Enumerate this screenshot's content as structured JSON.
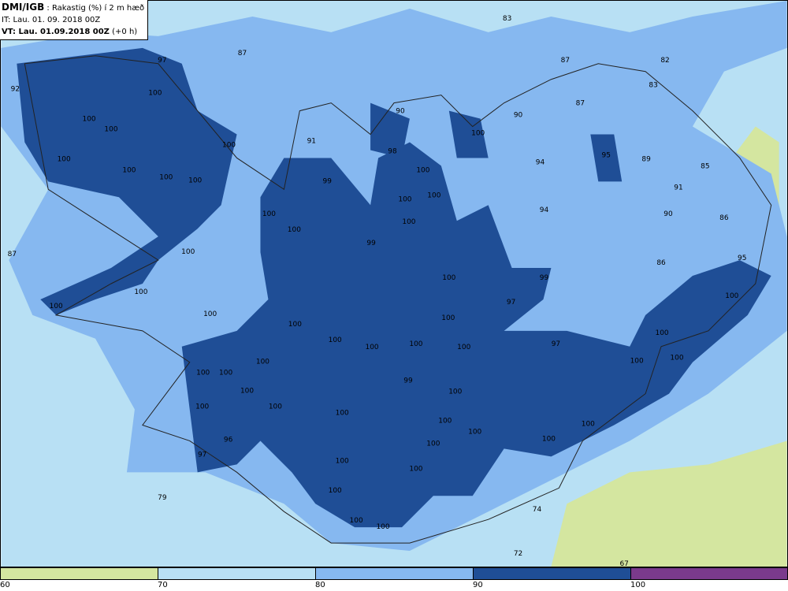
{
  "header": {
    "source": "DMI/IGB",
    "title": ": Rakastig (%) í 2 m hæð",
    "it": "IT: Lau. 01. 09. 2018 00Z",
    "vt_label": "VT: Lau. 01.09.2018 00Z",
    "vt_offset": "(+0 h)"
  },
  "legend": {
    "bins": [
      {
        "from": "60",
        "color": "#d4e6a0"
      },
      {
        "from": "70",
        "color": "#b8e0f4"
      },
      {
        "from": "80",
        "color": "#86b8f0"
      },
      {
        "from": "90",
        "color": "#1f4e96"
      },
      {
        "from": "100",
        "color": "#7a3a8c"
      }
    ]
  },
  "contour_labels": [
    "83",
    "87",
    "97",
    "87",
    "82",
    "92",
    "100",
    "83",
    "87",
    "90",
    "90",
    "100",
    "100",
    "100",
    "91",
    "100",
    "98",
    "95",
    "89",
    "100",
    "94",
    "85",
    "100",
    "100",
    "100",
    "100",
    "99",
    "91",
    "100",
    "100",
    "94",
    "90",
    "100",
    "100",
    "86",
    "100",
    "99",
    "100",
    "87",
    "86",
    "95",
    "100",
    "99",
    "100",
    "100",
    "97",
    "100",
    "100",
    "100",
    "100",
    "100",
    "100",
    "100",
    "100",
    "100",
    "97",
    "100",
    "100",
    "100",
    "100",
    "100",
    "99",
    "100",
    "100",
    "100",
    "100",
    "100",
    "100",
    "100",
    "100",
    "100",
    "96",
    "100",
    "97",
    "100",
    "100",
    "79",
    "100",
    "74",
    "100",
    "100",
    "72",
    "67"
  ]
}
